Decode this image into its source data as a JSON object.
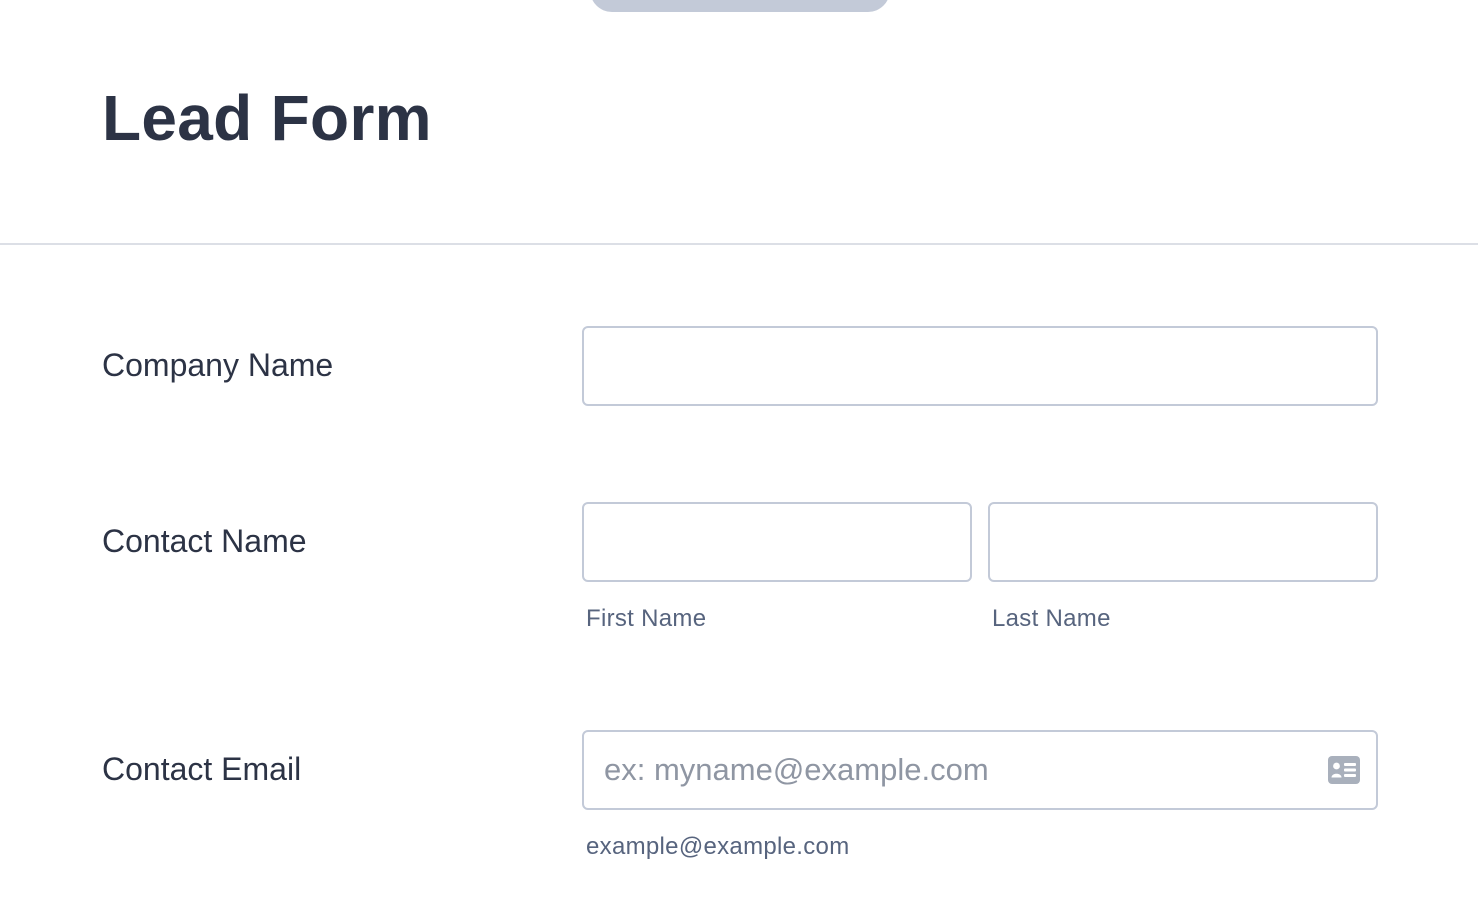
{
  "form": {
    "title": "Lead Form",
    "fields": {
      "company_name": {
        "label": "Company Name",
        "value": ""
      },
      "contact_name": {
        "label": "Contact Name",
        "first": {
          "value": "",
          "sublabel": "First Name"
        },
        "last": {
          "value": "",
          "sublabel": "Last Name"
        }
      },
      "contact_email": {
        "label": "Contact Email",
        "value": "",
        "placeholder": "ex: myname@example.com",
        "sublabel": "example@example.com",
        "icon": "contact-card-icon"
      }
    }
  },
  "colors": {
    "text": "#2c3345",
    "sublabel": "#57647e",
    "border": "#c3cad8",
    "divider": "#dcdfe6",
    "placeholder": "#8f96a3",
    "tab": "#c3cad8"
  }
}
